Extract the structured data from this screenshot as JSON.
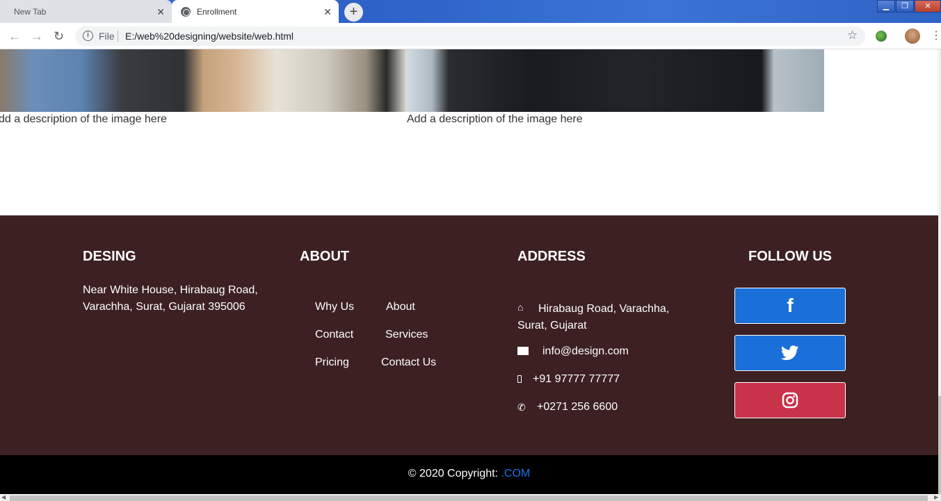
{
  "browser": {
    "tabs": [
      {
        "label": "New Tab"
      },
      {
        "label": "Enrollment"
      }
    ],
    "tab_close": "✕",
    "new_tab": "+",
    "file_label": "File",
    "url": "E:/web%20designing/website/web.html",
    "window": {
      "minimize": "▁",
      "maximize": "❐",
      "close": "✕"
    }
  },
  "gallery": {
    "captions": [
      "dd a description of the image here",
      "Add a description of the image here"
    ]
  },
  "footer": {
    "brand": {
      "heading": "DESING",
      "address": "Near White House, Hirabaug Road, Varachha, Surat, Gujarat 395006"
    },
    "about": {
      "heading": "ABOUT",
      "links": [
        "Why Us",
        "About",
        "Contact",
        "Services",
        "Pricing",
        "Contact Us"
      ]
    },
    "address": {
      "heading": "ADDRESS",
      "street": "Hirabaug Road, Varachha, Surat, Gujarat",
      "email": "info@design.com",
      "mobile": "+91 97777 77777",
      "phone": "+0271 256 6600"
    },
    "follow": {
      "heading": "FOLLOW US",
      "buttons": [
        {
          "name": "facebook",
          "icon": "f",
          "color": "#1a6fd8"
        },
        {
          "name": "twitter",
          "icon": "twitter-bird",
          "color": "#1a6fd8"
        },
        {
          "name": "instagram",
          "icon": "instagram-camera",
          "color": "#c8334a"
        }
      ]
    },
    "copyright": {
      "text": "© 2020 Copyright:",
      "link": ".COM"
    }
  },
  "colors": {
    "footer_bg": "#3c2022",
    "copyright_bg": "#000000",
    "link_blue": "#1a73e8"
  }
}
